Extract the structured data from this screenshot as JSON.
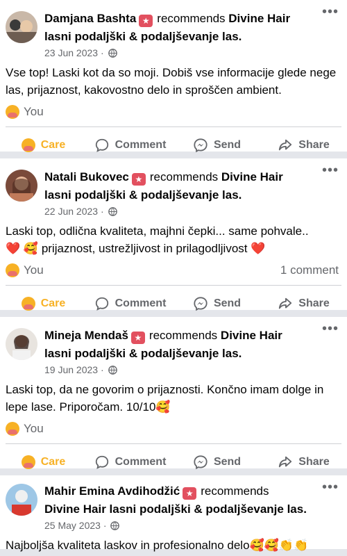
{
  "posts": [
    {
      "name": "Damjana Bashta",
      "recommends": "recommends",
      "page": "Divine Hair",
      "page_rest": "lasni podaljški & podaljševanje las.",
      "date": "23 Jun 2023",
      "text": "Vse top! Laski kot da so moji. Dobiš vse informacije glede nege las, prijaznost, kakovostno delo in sproščen ambient.",
      "reaction": "You",
      "comments": ""
    },
    {
      "name": "Natali Bukovec",
      "recommends": "recommends",
      "page": "Divine Hair",
      "page_rest": "lasni podaljški & podaljševanje las.",
      "date": "22 Jun 2023",
      "text_a": "Laski top, odlična kvaliteta, majhni čepki... same pohvale..",
      "text_b": "prijaznost, ustrežljivost in prilagodljivost",
      "reaction": "You",
      "comments": "1 comment"
    },
    {
      "name": "Mineja Mendaš",
      "recommends": "recommends",
      "page": "Divine Hair",
      "page_rest": "lasni podaljški & podaljševanje las.",
      "date": "19 Jun 2023",
      "text": "Laski top, da ne govorim o prijaznosti. Končno imam dolge in lepe lase. Priporočam. 10/10🥰",
      "reaction": "You",
      "comments": ""
    },
    {
      "name": "Mahir Emina Avdihodžić",
      "recommends": "recommends",
      "page_full": "Divine Hair lasni podaljški & podaljševanje las.",
      "date": "25 May 2023",
      "text": "Najboljša kvaliteta laskov in profesionalno delo🥰🥰👏👏"
    }
  ],
  "actions": {
    "care": "Care",
    "comment": "Comment",
    "send": "Send",
    "share": "Share"
  },
  "colors": {
    "care": "#f7b125",
    "badge": "#e2505f",
    "muted": "#65676b",
    "heart": "#e0245e"
  },
  "icons": [
    "globe-icon",
    "comment-icon",
    "messenger-icon",
    "share-icon",
    "care-emoji-icon",
    "more-icon",
    "recommend-badge-icon"
  ]
}
